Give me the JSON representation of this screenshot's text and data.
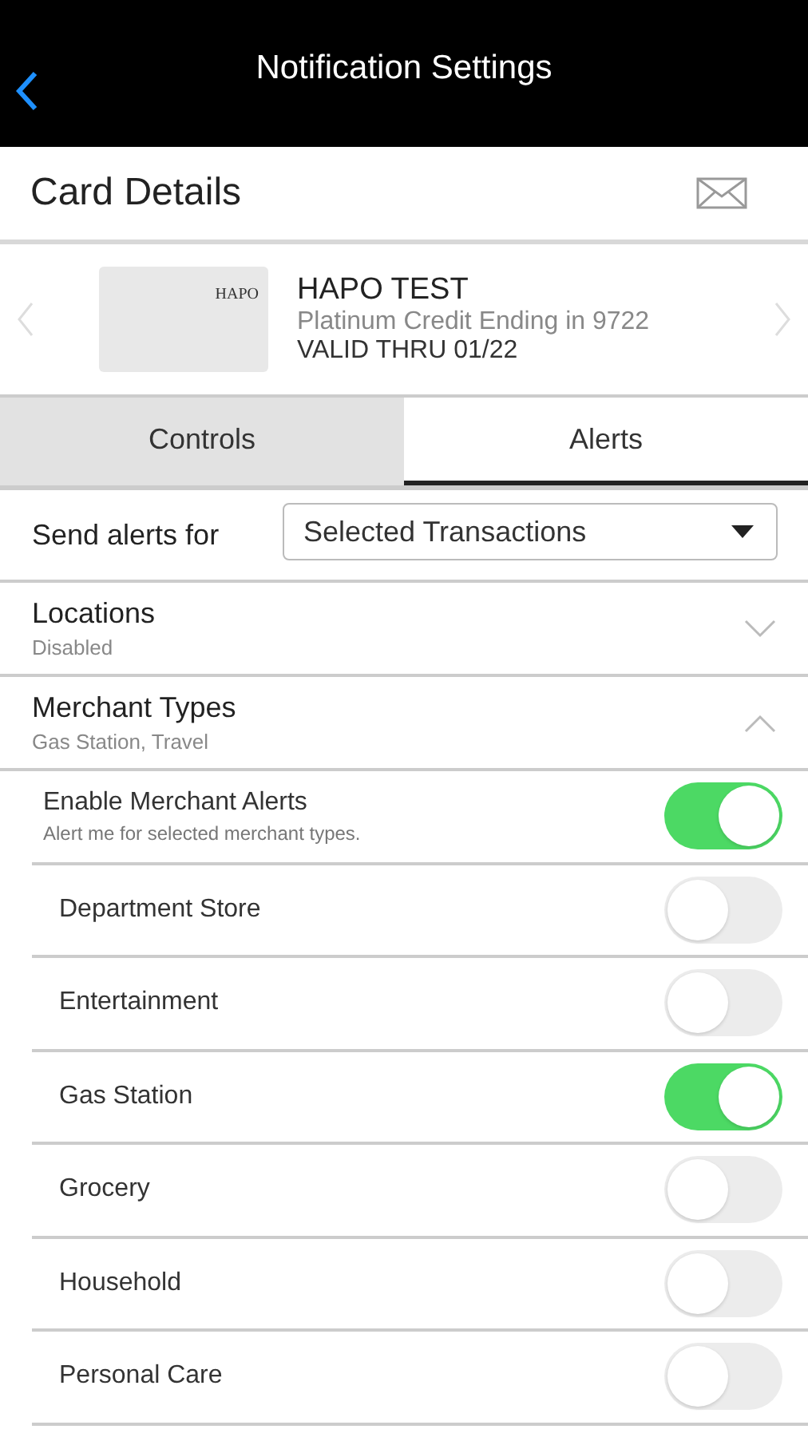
{
  "header": {
    "title": "Notification Settings"
  },
  "card_details": {
    "title": "Card Details"
  },
  "card": {
    "logo": "HAPO",
    "name": "HAPO TEST",
    "description": "Platinum Credit Ending in 9722",
    "valid": "VALID THRU 01/22"
  },
  "tabs": [
    {
      "label": "Controls",
      "selected": false
    },
    {
      "label": "Alerts",
      "selected": true
    }
  ],
  "send_alerts": {
    "label": "Send alerts for",
    "value": "Selected Transactions"
  },
  "sections": [
    {
      "title": "Locations",
      "subtitle": "Disabled",
      "expanded": false
    },
    {
      "title": "Merchant Types",
      "subtitle": "Gas Station, Travel",
      "expanded": true
    }
  ],
  "enable": {
    "title": "Enable Merchant Alerts",
    "subtitle": "Alert me for selected merchant types.",
    "on": true
  },
  "merchant_types": [
    {
      "label": "Department Store",
      "on": false
    },
    {
      "label": "Entertainment",
      "on": false
    },
    {
      "label": "Gas Station",
      "on": true
    },
    {
      "label": "Grocery",
      "on": false
    },
    {
      "label": "Household",
      "on": false
    },
    {
      "label": "Personal Care",
      "on": false
    }
  ]
}
